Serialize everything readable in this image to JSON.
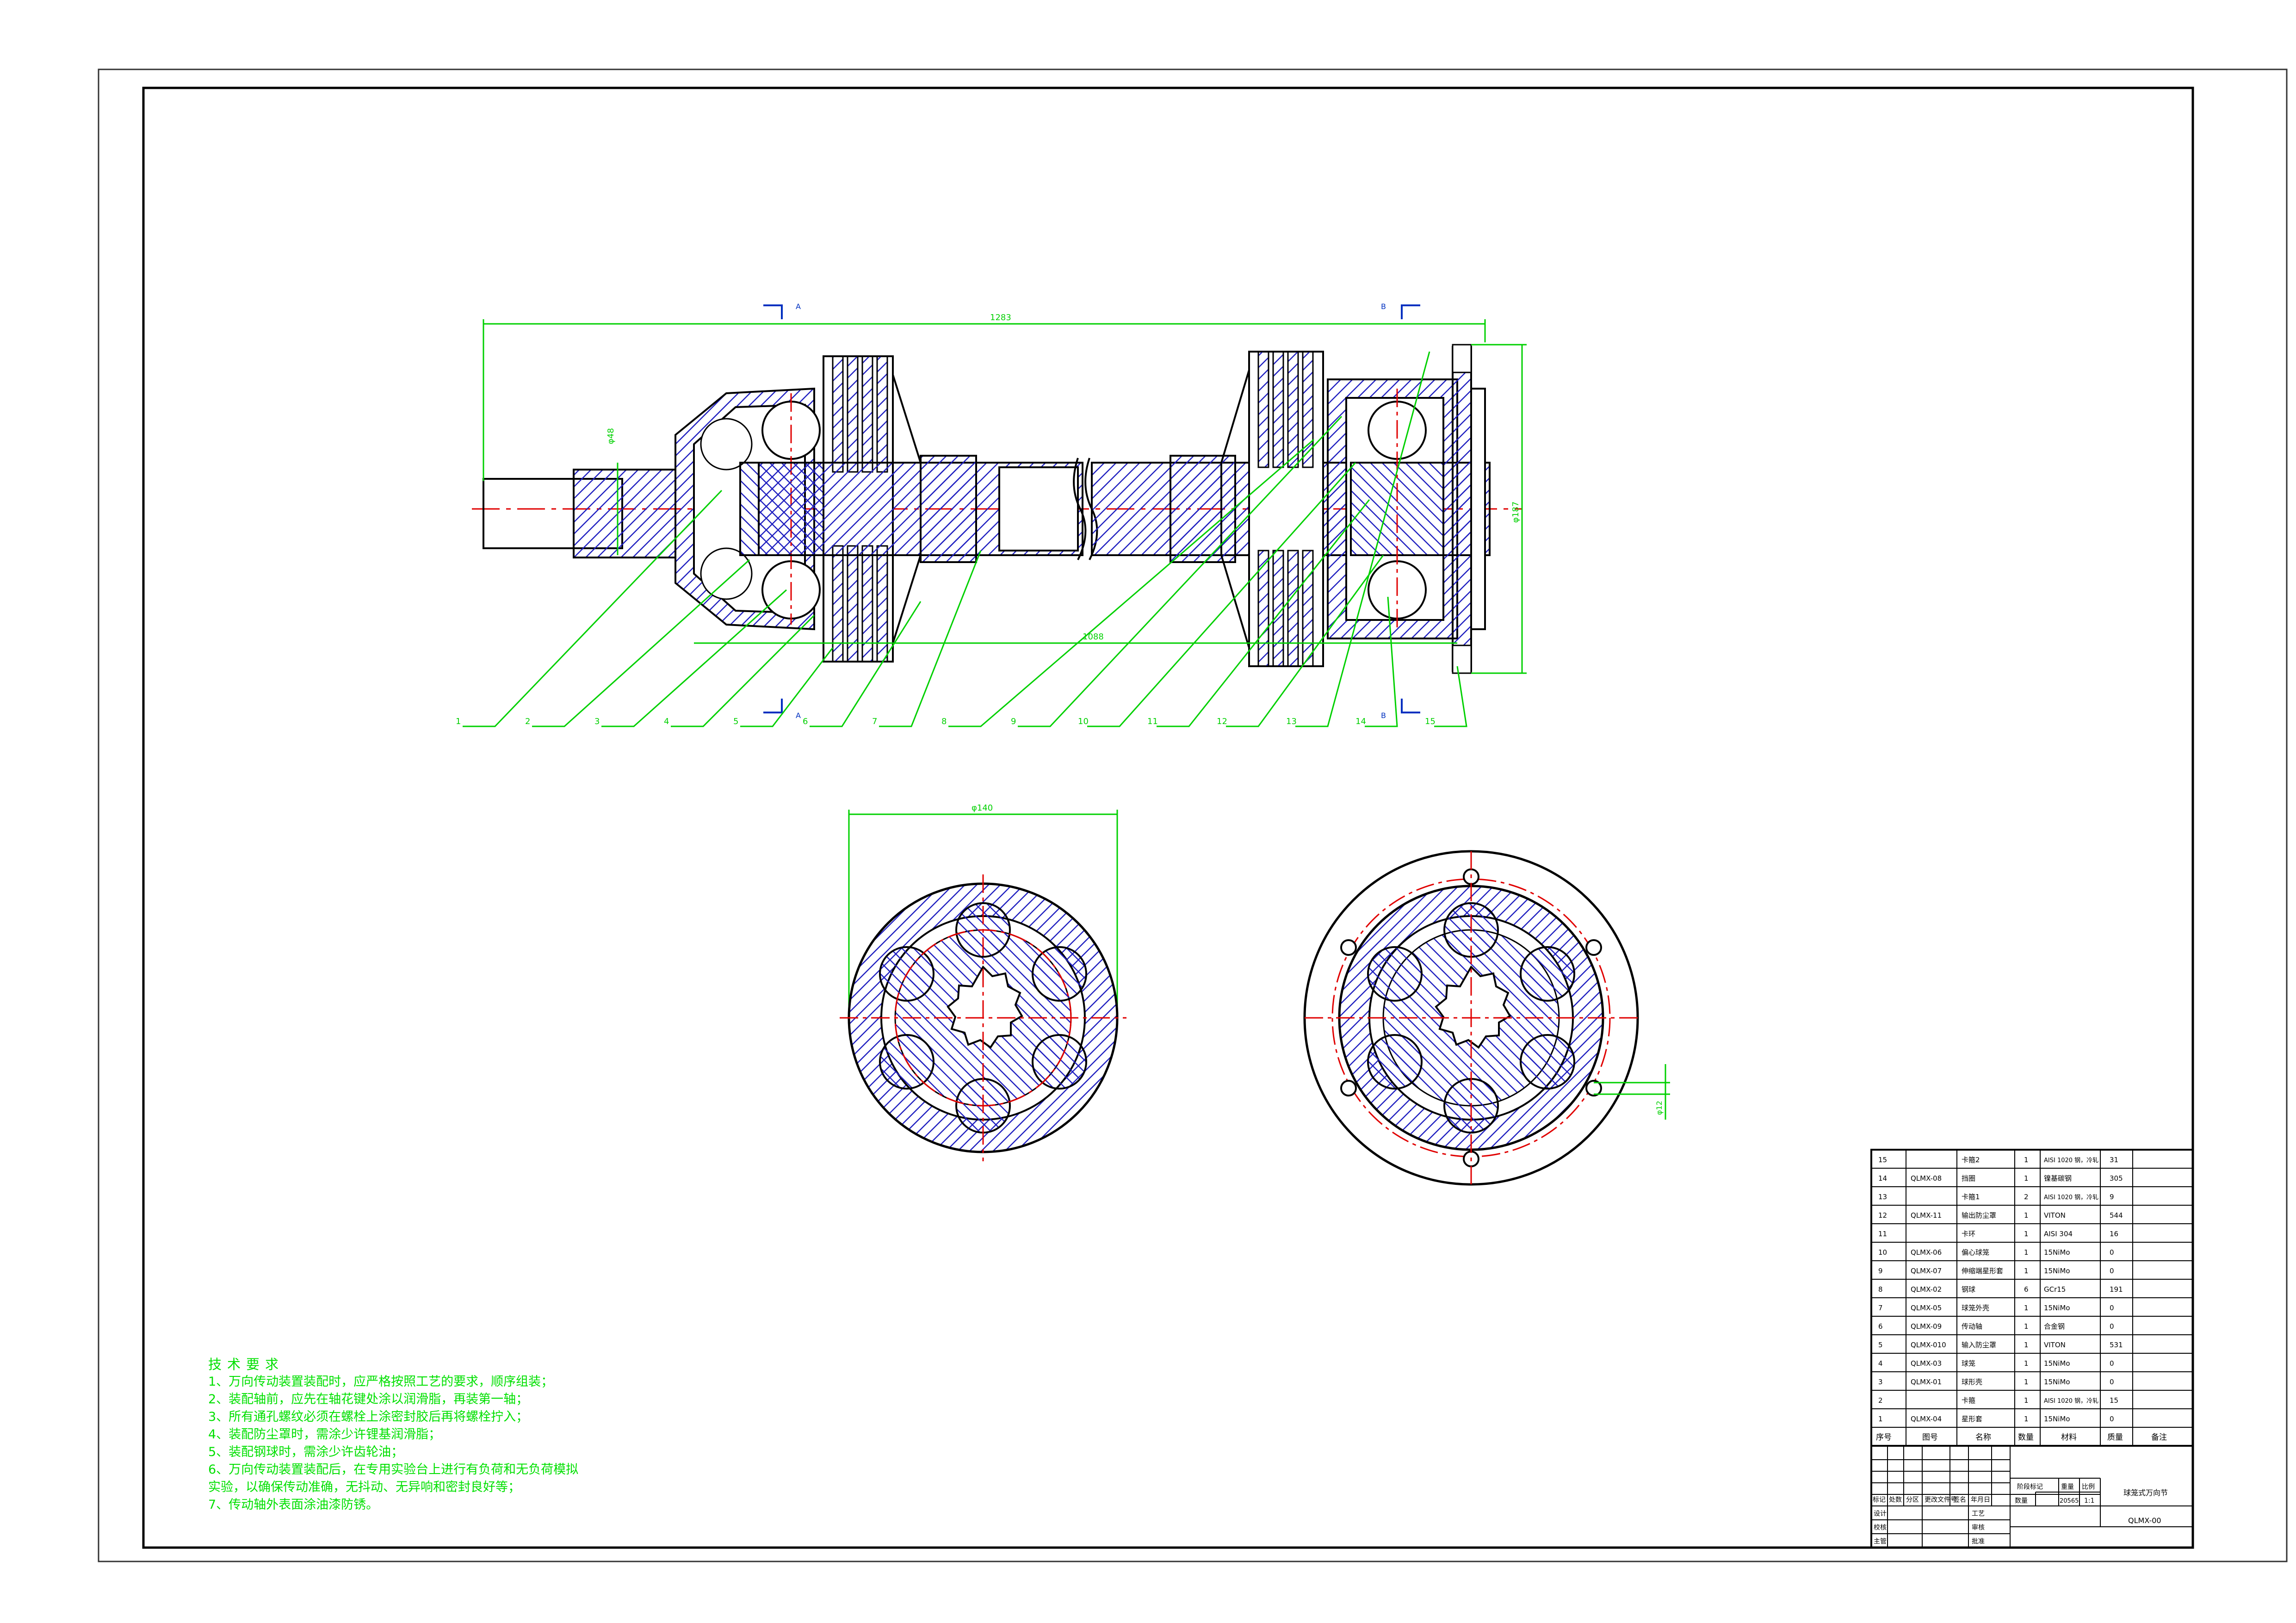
{
  "drawing": {
    "dimensions": {
      "overall_length": "1283",
      "shaft_length": "1088",
      "left_diameter": "φ48",
      "right_diameter": "φ187",
      "section_a_diameter": "φ140",
      "hole_diameter": "φ12"
    },
    "section_marks": {
      "a": "A",
      "b": "B"
    },
    "balloons": [
      "1",
      "2",
      "3",
      "4",
      "5",
      "6",
      "7",
      "8",
      "9",
      "10",
      "11",
      "12",
      "13",
      "14",
      "15"
    ]
  },
  "tech_notes": {
    "title": "技术要求",
    "lines": [
      "1、万向传动装置装配时，应严格按照工艺的要求，顺序组装；",
      "2、装配轴前，应先在轴花键处涂以润滑脂，再装第一轴；",
      "3、所有通孔螺纹必须在螺栓上涂密封胶后再将螺栓拧入；",
      "4、装配防尘罩时，需涂少许锂基润滑脂；",
      "5、装配钢球时，需涂少许齿轮油；",
      "6、万向传动装置装配后，在专用实验台上进行有负荷和无负荷模拟",
      "   实验，以确保传动准确，无抖动、无异响和密封良好等；",
      "7、传动轴外表面涂油漆防锈。"
    ]
  },
  "bom": {
    "rows": [
      [
        "15",
        "",
        "卡箍2",
        "1",
        "AISI 1020 钢，冷轧",
        "31",
        ""
      ],
      [
        "14",
        "QLMX-08",
        "挡圈",
        "1",
        "镍基碳钢",
        "305",
        ""
      ],
      [
        "13",
        "",
        "卡箍1",
        "2",
        "AISI 1020 钢，冷轧",
        "9",
        ""
      ],
      [
        "12",
        "QLMX-11",
        "输出防尘罩",
        "1",
        "VITON",
        "544",
        ""
      ],
      [
        "11",
        "",
        "卡环",
        "1",
        "AISI 304",
        "16",
        ""
      ],
      [
        "10",
        "QLMX-06",
        "偏心球笼",
        "1",
        "15NiMo",
        "0",
        ""
      ],
      [
        "9",
        "QLMX-07",
        "伸缩端星形套",
        "1",
        "15NiMo",
        "0",
        ""
      ],
      [
        "8",
        "QLMX-02",
        "钢球",
        "6",
        "GCr15",
        "191",
        ""
      ],
      [
        "7",
        "QLMX-05",
        "球笼外壳",
        "1",
        "15NiMo",
        "0",
        ""
      ],
      [
        "6",
        "QLMX-09",
        "传动轴",
        "1",
        "合金钢",
        "0",
        ""
      ],
      [
        "5",
        "QLMX-010",
        "输入防尘罩",
        "1",
        "VITON",
        "531",
        ""
      ],
      [
        "4",
        "QLMX-03",
        "球笼",
        "1",
        "15NiMo",
        "0",
        ""
      ],
      [
        "3",
        "QLMX-01",
        "球形壳",
        "1",
        "15NiMo",
        "0",
        ""
      ],
      [
        "2",
        "",
        "卡箍",
        "1",
        "AISI 1020 钢，冷轧",
        "15",
        ""
      ],
      [
        "1",
        "QLMX-04",
        "星形套",
        "1",
        "15NiMo",
        "0",
        ""
      ]
    ],
    "header": [
      "序号",
      "图号",
      "名称",
      "数量",
      "材料",
      "质量",
      "备注"
    ]
  },
  "title_block": {
    "drawing_name": "球笼式万向节",
    "drawing_number": "QLMX-00",
    "stage_mark_label": "阶段标记",
    "weight_label": "重量",
    "scale_label": "比例",
    "scale_value": "1:1",
    "weight_value": "20565",
    "count_label": "数量",
    "rev_headers": [
      "标记",
      "处数",
      "分区",
      "更改文件号",
      "签名",
      "年月日"
    ],
    "roles": [
      "设计",
      "校核",
      "主管"
    ],
    "roles2": [
      "工艺",
      "审核",
      "批准"
    ]
  },
  "colors": {
    "outline": "#000000",
    "dimension": "#00d000",
    "hatch": "#2020c0",
    "centerline": "#e00000"
  }
}
